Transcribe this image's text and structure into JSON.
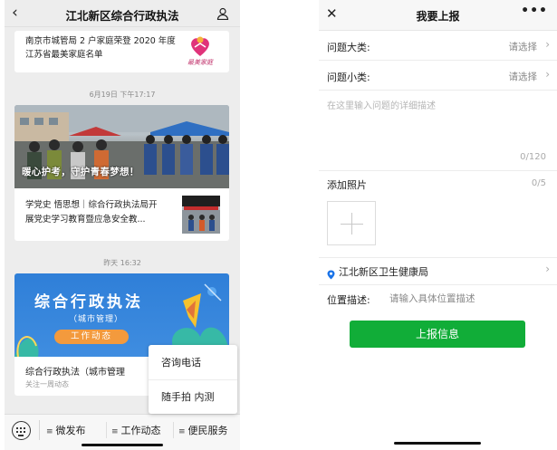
{
  "left": {
    "nav": {
      "title": "江北新区综合行政执法"
    },
    "card1": {
      "text": "南京市城管局 2 户家庭荣登 2020 年度江苏省最美家庭名单",
      "logo_text": "最美家庭"
    },
    "timestamp1": "6月19日 下午17:17",
    "card2": {
      "slogan": "暖心护考，守护青春梦想！",
      "subtitle": "学党史 悟思想｜综合行政执法局开展党史学习教育暨应急安全教..."
    },
    "timestamp2": "昨天 16:32",
    "card3": {
      "banner_title": "综合行政执法",
      "banner_sub": "（城市管理）",
      "banner_chip": "工作动态",
      "title": "综合行政执法（城市管理",
      "meta": "关注一周动态"
    },
    "popup": {
      "item1": "咨询电话",
      "item2": "随手拍 内测"
    },
    "bottom_menu": [
      "微发布",
      "工作动态",
      "便民服务"
    ]
  },
  "right": {
    "nav": {
      "title": "我要上报"
    },
    "rows": [
      {
        "label": "问题大类:",
        "value": "请选择"
      },
      {
        "label": "问题小类:",
        "value": "请选择"
      }
    ],
    "desc_placeholder": "在这里输入问题的详细描述",
    "desc_counter": "0/120",
    "photo_label": "添加照片",
    "photo_counter": "0/5",
    "location": "江北新区卫生健康局",
    "position_label": "位置描述:",
    "position_placeholder": "请输入具体位置描述",
    "submit_label": "上报信息"
  },
  "colors": {
    "accent_green": "#11ad38",
    "banner_blue": "#2f7fd8",
    "chip_orange": "#f39a3d",
    "location_blue": "#1a73e8"
  }
}
